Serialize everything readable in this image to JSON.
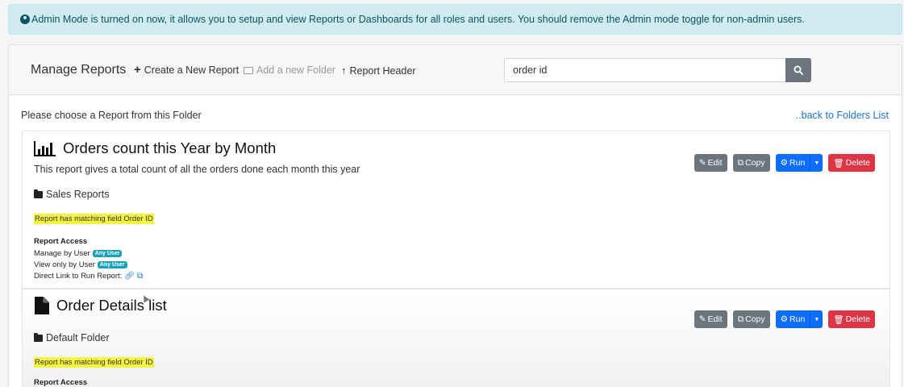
{
  "alert": {
    "text": "Admin Mode is turned on now, it allows you to setup and view Reports or Dashboards for all roles and users. You should remove the Admin mode toggle for non-admin users."
  },
  "header": {
    "title": "Manage Reports",
    "create_label": "Create a New Report",
    "add_folder_label": "Add a new Folder",
    "report_header_label": "Report Header",
    "search_value": "order id"
  },
  "folder_view": {
    "choose_text": "Please choose a Report from this Folder",
    "back_link": "..back to Folders List"
  },
  "buttons": {
    "edit": "Edit",
    "copy": "Copy",
    "run": "Run",
    "delete": "Delete"
  },
  "reports": [
    {
      "title": "Orders count this Year by Month",
      "icon": "bar-chart-icon",
      "description": "This report gives a total count of all the orders done each month this year",
      "folder": "Sales Reports",
      "match": "Report has matching field Order ID",
      "access_heading": "Report Access",
      "manage_label": "Manage by User",
      "manage_badge": "Any User",
      "view_label": "View only by User",
      "view_badge": "Any User",
      "direct_link_label": "Direct Link to Run Report:"
    },
    {
      "title": "Order Details list",
      "icon": "file-icon",
      "folder": "Default Folder",
      "match": "Report has matching field Order ID",
      "access_heading": "Report Access"
    }
  ],
  "colors": {
    "run": "#0d6efd",
    "delete": "#dc3545",
    "edit_copy": "#6c757d",
    "alert_bg": "#d1ecf1",
    "highlight": "#f5f541",
    "badge": "#17a2b8"
  }
}
